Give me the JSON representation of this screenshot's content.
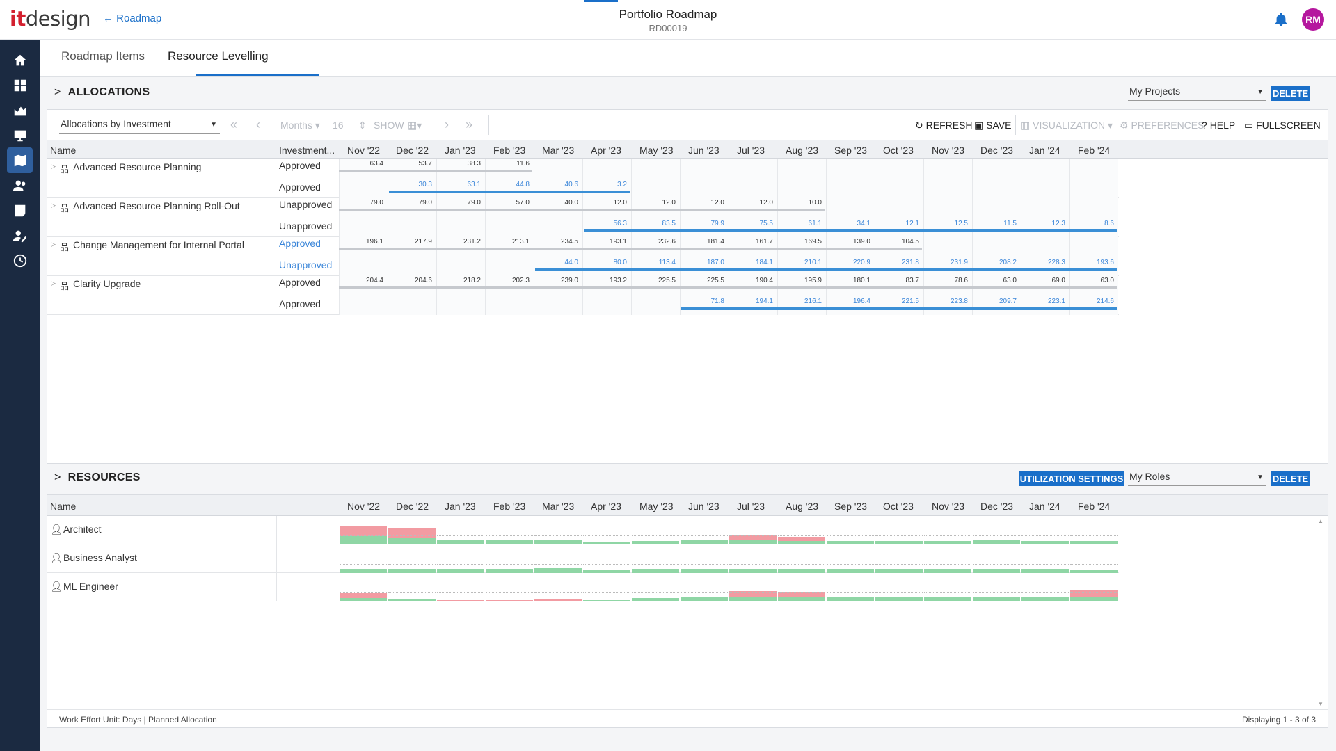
{
  "app": {
    "logo_it": "it",
    "logo_design": "design",
    "back_label": "← Roadmap",
    "title": "Portfolio Roadmap",
    "code": "RD00019",
    "avatar": "RM"
  },
  "tabs": [
    "Roadmap Items",
    "Resource Levelling"
  ],
  "allocations": {
    "heading": "ALLOCATIONS",
    "filter": "My Projects",
    "delete": "DELETE",
    "view": "Allocations by Investment",
    "period": "Months",
    "count": "16",
    "show": "SHOW",
    "toolbar": {
      "refresh": "REFRESH",
      "save": "SAVE",
      "visualization": "VISUALIZATION",
      "preferences": "PREFERENCES",
      "help": "HELP",
      "fullscreen": "FULLSCREEN"
    },
    "col_name": "Name",
    "col_status": "Investment...",
    "months": [
      "Nov '22",
      "Dec '22",
      "Jan '23",
      "Feb '23",
      "Mar '23",
      "Apr '23",
      "May '23",
      "Jun '23",
      "Jul '23",
      "Aug '23",
      "Sep '23",
      "Oct '23",
      "Nov '23",
      "Dec '23",
      "Jan '24",
      "Feb '24"
    ],
    "rows": [
      {
        "name": "Advanced Resource Planning",
        "s1": "Approved",
        "s2": "Approved",
        "s1blue": false,
        "s2blue": false,
        "a": {
          "start": 0,
          "vals": [
            "63.4",
            "53.7",
            "38.3",
            "11.6"
          ]
        },
        "b": {
          "start": 1,
          "vals": [
            "30.3",
            "63.1",
            "44.8",
            "40.6",
            "3.2"
          ]
        }
      },
      {
        "name": "Advanced Resource Planning Roll-Out",
        "s1": "Unapproved",
        "s2": "Unapproved",
        "s1blue": false,
        "s2blue": false,
        "a": {
          "start": 0,
          "vals": [
            "79.0",
            "79.0",
            "79.0",
            "57.0",
            "40.0",
            "12.0",
            "12.0",
            "12.0",
            "12.0",
            "10.0"
          ]
        },
        "b": {
          "start": 5,
          "vals": [
            "56.3",
            "83.5",
            "79.9",
            "75.5",
            "61.1",
            "34.1",
            "12.1",
            "12.5",
            "11.5",
            "12.3",
            "8.6"
          ]
        }
      },
      {
        "name": "Change Management for Internal Portal",
        "s1": "Approved",
        "s2": "Unapproved",
        "s1blue": true,
        "s2blue": true,
        "a": {
          "start": 0,
          "vals": [
            "196.1",
            "217.9",
            "231.2",
            "213.1",
            "234.5",
            "193.1",
            "232.6",
            "181.4",
            "161.7",
            "169.5",
            "139.0",
            "104.5"
          ]
        },
        "b": {
          "start": 4,
          "vals": [
            "44.0",
            "80.0",
            "113.4",
            "187.0",
            "184.1",
            "210.1",
            "220.9",
            "231.8",
            "231.9",
            "208.2",
            "228.3",
            "193.6"
          ]
        }
      },
      {
        "name": "Clarity Upgrade",
        "s1": "Approved",
        "s2": "Approved",
        "s1blue": false,
        "s2blue": false,
        "a": {
          "start": 0,
          "vals": [
            "204.4",
            "204.6",
            "218.2",
            "202.3",
            "239.0",
            "193.2",
            "225.5",
            "225.5",
            "190.4",
            "195.9",
            "180.1",
            "83.7",
            "78.6",
            "63.0",
            "69.0",
            "63.0"
          ]
        },
        "b": {
          "start": 7,
          "vals": [
            "71.8",
            "194.1",
            "216.1",
            "196.4",
            "221.5",
            "223.8",
            "209.7",
            "223.1",
            "214.6"
          ]
        }
      }
    ]
  },
  "resources": {
    "heading": "RESOURCES",
    "util_settings": "UTILIZATION SETTINGS",
    "filter": "My Roles",
    "delete": "DELETE",
    "col_name": "Name",
    "rows": [
      {
        "name": "Architect",
        "levels": [
          0.75,
          0.65,
          0.4,
          0.35,
          0.35,
          0.25,
          0.3,
          0.4,
          0.35,
          0.3,
          0.3,
          0.3,
          0.3,
          0.35,
          0.3,
          0.3
        ],
        "over": [
          0.95,
          0.85,
          0,
          0,
          0,
          0,
          0,
          0,
          0.45,
          0.4,
          0,
          0,
          0,
          0,
          0,
          0
        ]
      },
      {
        "name": "Business Analyst",
        "levels": [
          0.35,
          0.35,
          0.35,
          0.4,
          0.45,
          0.3,
          0.35,
          0.35,
          0.35,
          0.35,
          0.35,
          0.35,
          0.35,
          0.35,
          0.35,
          0.3
        ],
        "over": [
          0,
          0,
          0,
          0,
          0,
          0,
          0,
          0,
          0,
          0,
          0,
          0,
          0,
          0,
          0,
          0
        ]
      },
      {
        "name": "ML Engineer",
        "levels": [
          0.3,
          0.25,
          0,
          0,
          0,
          0.15,
          0.3,
          0.45,
          0.45,
          0.4,
          0.45,
          0.45,
          0.45,
          0.45,
          0.45,
          0.45
        ],
        "over": [
          0.45,
          0,
          0.1,
          0.1,
          0.25,
          0,
          0,
          0,
          0.5,
          0.5,
          0,
          0,
          0,
          0,
          0,
          0.65
        ]
      }
    ],
    "colors": {
      "green": "#8fd6a5",
      "red": "#f29ba2"
    },
    "footer_left": "Work Effort Unit: Days | Planned Allocation",
    "footer_right": "Displaying 1 - 3 of 3"
  }
}
